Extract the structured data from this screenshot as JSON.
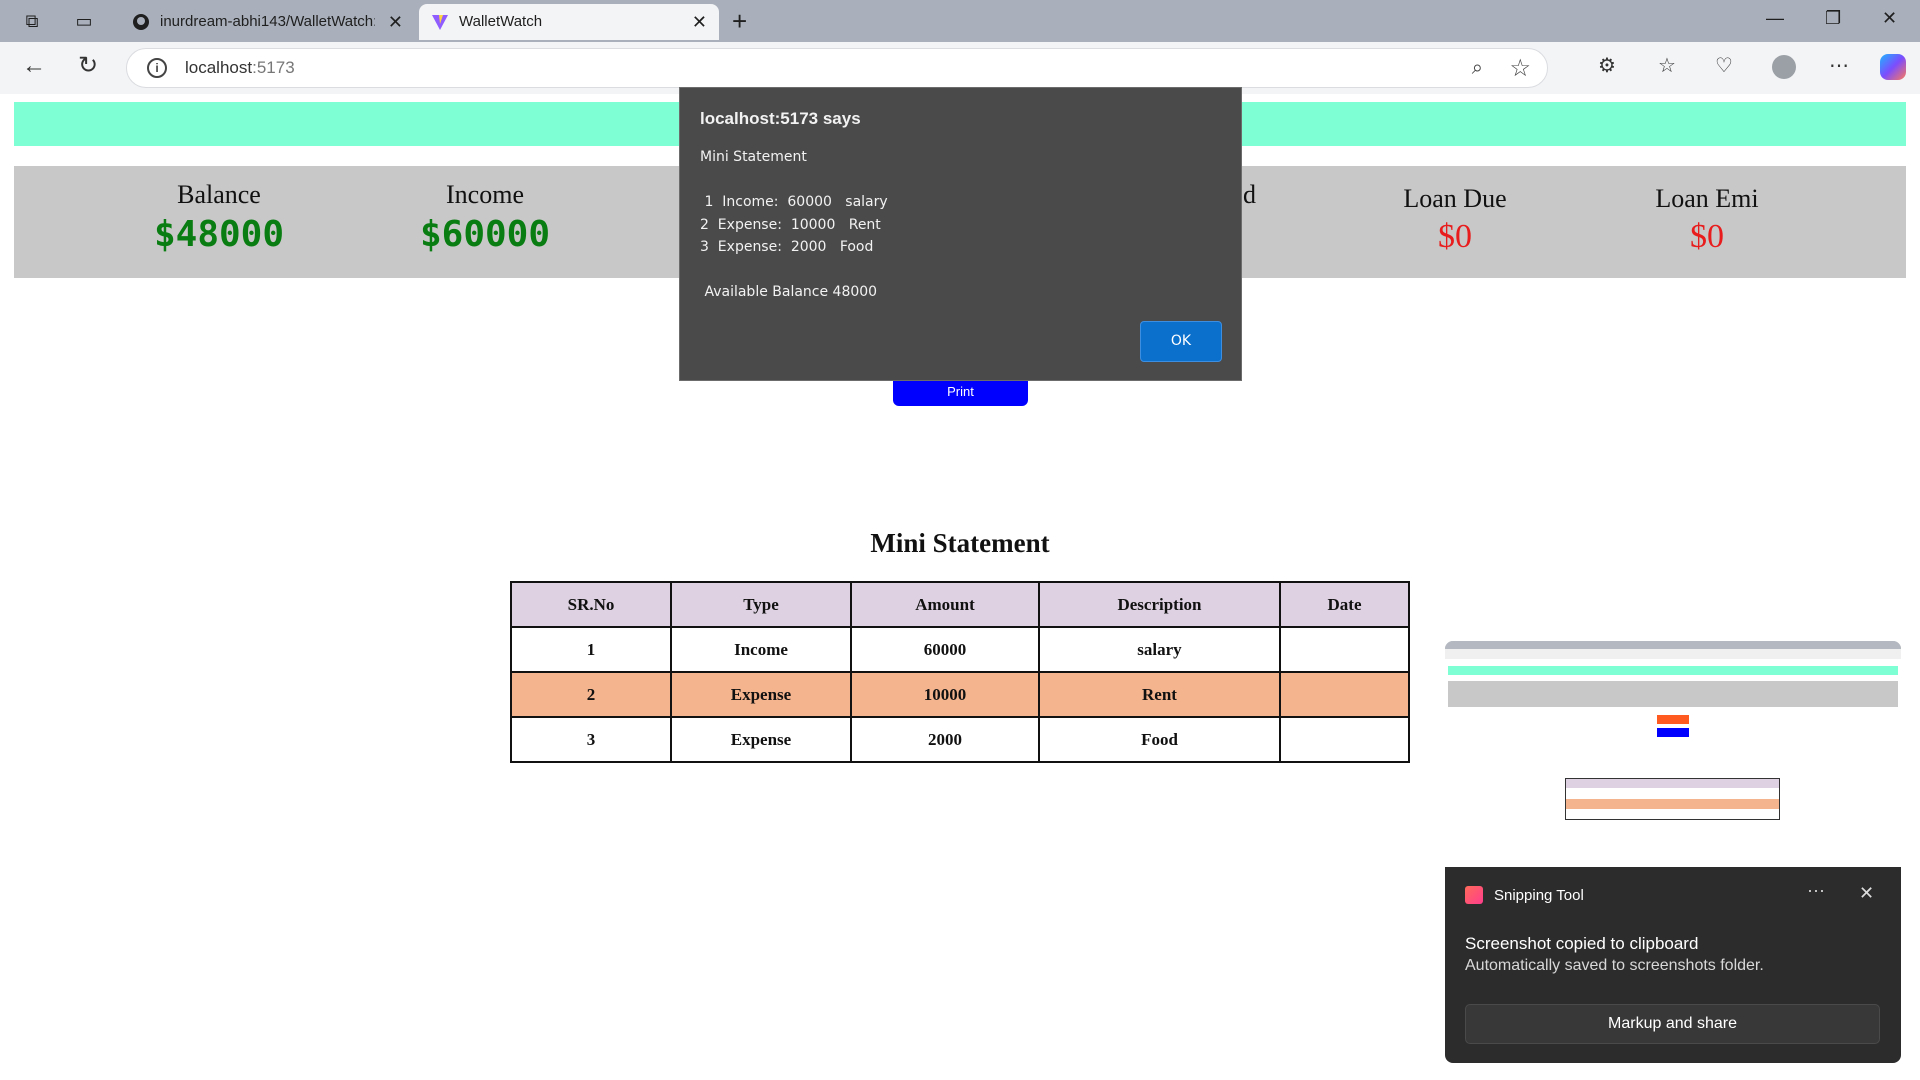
{
  "browser": {
    "tabs": [
      {
        "title": "inurdream-abhi143/WalletWatch:"
      },
      {
        "title": "WalletWatch"
      }
    ],
    "url_host": "localhost",
    "url_port": ":5173"
  },
  "summary": {
    "balance_label": "Balance",
    "balance_value": "$48000",
    "income_label": "Income",
    "income_value": "$60000",
    "partial_label": "d",
    "loan_due_label": "Loan Due",
    "loan_due_value": "$0",
    "loan_emi_label": "Loan Emi",
    "loan_emi_value": "$0"
  },
  "print_label": "Print",
  "mini_statement": {
    "title": "Mini Statement",
    "headers": [
      "SR.No",
      "Type",
      "Amount",
      "Description",
      "Date"
    ],
    "rows": [
      {
        "sr": "1",
        "type": "Income",
        "amount": "60000",
        "description": "salary",
        "date": ""
      },
      {
        "sr": "2",
        "type": "Expense",
        "amount": "10000",
        "description": "Rent",
        "date": ""
      },
      {
        "sr": "3",
        "type": "Expense",
        "amount": "2000",
        "description": "Food",
        "date": ""
      }
    ]
  },
  "alert": {
    "title": "localhost:5173 says",
    "message": "Mini Statement\n\n 1  Income:  60000   salary\n2  Expense:  10000   Rent\n3  Expense:  2000   Food\n\n Available Balance 48000",
    "ok_label": "OK"
  },
  "snipping_toast": {
    "app_name": "Snipping Tool",
    "headline": "Screenshot copied to clipboard",
    "detail": "Automatically saved to screenshots folder.",
    "action_label": "Markup and share"
  },
  "colors": {
    "header_strip": "#7fffd4",
    "summary_bg": "#c8c8c8",
    "positive": "#0a7d12",
    "negative": "#e81c1c",
    "print_button": "#0000ff",
    "highlight_row": "#f4b48e",
    "table_header": "#ded2e2"
  }
}
